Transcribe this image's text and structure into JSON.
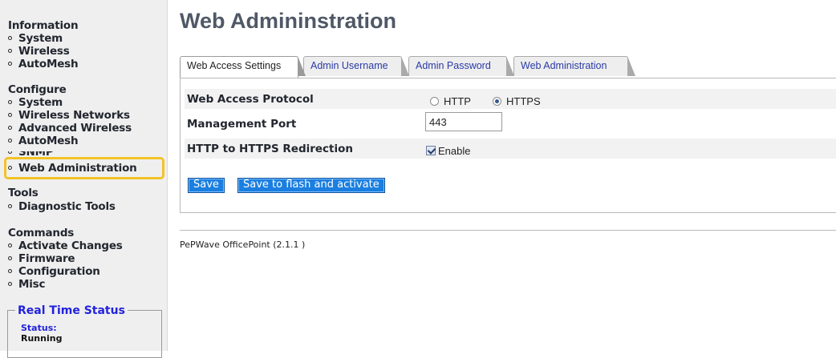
{
  "sidebar": {
    "information": {
      "title": "Information",
      "items": [
        "System",
        "Wireless",
        "AutoMesh"
      ]
    },
    "configure": {
      "title": "Configure",
      "items": [
        "System",
        "Wireless Networks",
        "Advanced Wireless",
        "AutoMesh",
        "SNMP",
        "Web Administration"
      ],
      "highlighted": "Web Administration"
    },
    "tools": {
      "title": "Tools",
      "items": [
        "Diagnostic Tools"
      ]
    },
    "commands": {
      "title": "Commands",
      "items": [
        "Activate Changes",
        "Firmware",
        "Configuration",
        "Misc"
      ]
    },
    "realtime": {
      "title": "Real Time Status",
      "status_label": "Status:",
      "status_value": "Running"
    }
  },
  "main": {
    "title": "Web Admininstration",
    "tabs": [
      {
        "label": "Web Access Settings",
        "active": true
      },
      {
        "label": "Admin Username",
        "active": false
      },
      {
        "label": "Admin Password",
        "active": false
      },
      {
        "label": "Web Administration",
        "active": false
      }
    ],
    "form": {
      "protocol": {
        "label": "Web Access Protocol",
        "options": [
          "HTTP",
          "HTTPS"
        ],
        "selected": "HTTPS"
      },
      "port": {
        "label": "Management Port",
        "value": "443"
      },
      "redirect": {
        "label": "HTTP to HTTPS Redirection",
        "checkbox_label": "Enable",
        "checked": true
      }
    },
    "buttons": {
      "save": "Save",
      "save_activate": "Save to flash and activate"
    },
    "footer": "PePWave OfficePoint (2.1.1 )"
  },
  "colors": {
    "highlight": "#f3c227",
    "button": "#1a7fe0",
    "tab_text": "#2a3aa8",
    "realtime_title": "#2222dd"
  }
}
